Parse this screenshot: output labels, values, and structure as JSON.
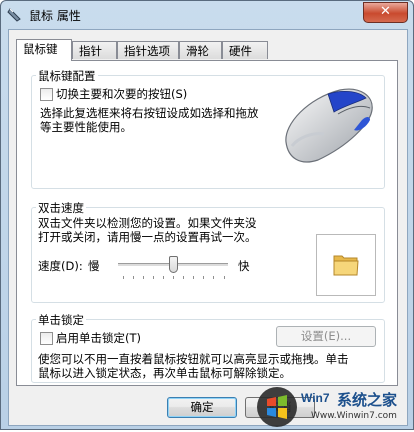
{
  "window": {
    "title": "鼠标 属性",
    "close_label": "✕"
  },
  "tabs": [
    "鼠标键",
    "指针",
    "指针选项",
    "滑轮",
    "硬件"
  ],
  "buttons_config": {
    "legend": "鼠标键配置",
    "swap_label": "切换主要和次要的按钮(S)",
    "description_line1": "选择此复选框来将右按钮设成如选择和拖放",
    "description_line2": "等主要性能使用。"
  },
  "double_click": {
    "legend": "双击速度",
    "description_line1": "双击文件夹以检测您的设置。如果文件夹没",
    "description_line2": "打开或关闭，请用慢一点的设置再试一次。",
    "speed_label": "速度(D):",
    "slow_label": "慢",
    "fast_label": "快",
    "speed_value_fraction": 0.5
  },
  "click_lock": {
    "legend": "单击锁定",
    "enable_label": "启用单击锁定(T)",
    "settings_button": "设置(E)...",
    "description_line1": "使您可以不用一直按着鼠标按钮就可以高亮显示或拖拽。单击",
    "description_line2": "鼠标以进入锁定状态，再次单击鼠标可解除锁定。"
  },
  "footer": {
    "ok": "确定",
    "cancel": "取消"
  },
  "watermark": {
    "brand": "系统之家",
    "url": "Www.Winwin7.com",
    "logo_text": "Win7"
  }
}
